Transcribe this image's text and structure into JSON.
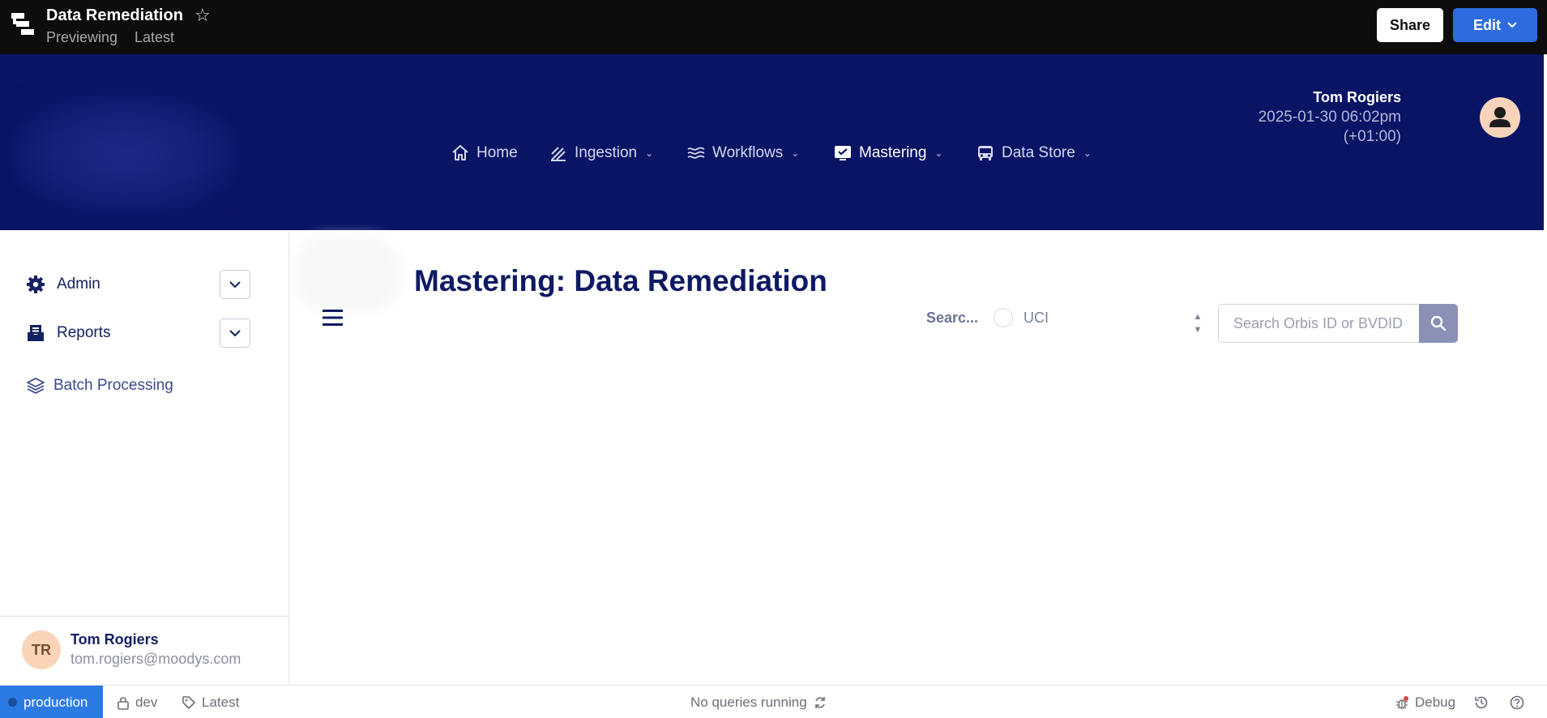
{
  "topbar": {
    "title": "Data Remediation",
    "status": "Previewing",
    "version": "Latest",
    "share_label": "Share",
    "edit_label": "Edit"
  },
  "header": {
    "nav": [
      {
        "label": "Home",
        "icon": "home-icon"
      },
      {
        "label": "Ingestion",
        "icon": "ingestion-icon"
      },
      {
        "label": "Workflows",
        "icon": "workflows-icon"
      },
      {
        "label": "Mastering",
        "icon": "mastering-icon",
        "active": true
      },
      {
        "label": "Data Store",
        "icon": "data-store-icon"
      }
    ],
    "user_name": "Tom Rogiers",
    "user_time": "2025-01-30 06:02pm",
    "user_tz": "(+01:00)"
  },
  "sidebar": {
    "items": [
      {
        "label": "Admin",
        "icon": "gear-icon"
      },
      {
        "label": "Reports",
        "icon": "reports-icon"
      }
    ],
    "link": {
      "label": "Batch Processing",
      "icon": "layers-icon"
    },
    "footer": {
      "initials": "TR",
      "name": "Tom Rogiers",
      "email": "tom.rogiers@moodys.com"
    }
  },
  "main": {
    "title": "Mastering: Data Remediation",
    "search_label": "Searc...",
    "radio_label": "UCI",
    "search_placeholder": "Search Orbis ID or BVDID"
  },
  "statusbar": {
    "environment": "production",
    "branch": "dev",
    "tag": "Latest",
    "queries": "No queries running",
    "debug": "Debug"
  },
  "colors": {
    "header_bg": "#0a1465",
    "topbar_bg": "#0d0d0d",
    "edit_button": "#2d6cdf",
    "environment_badge": "#2c7be5",
    "search_button": "#8a90b6"
  }
}
